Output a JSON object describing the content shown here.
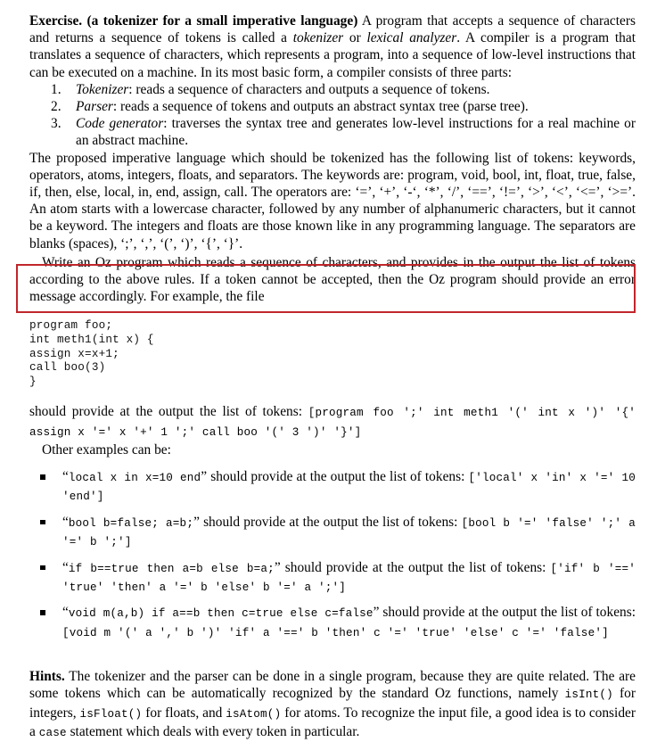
{
  "document": {
    "intro": {
      "heading": "Exercise.",
      "subheading": "(a tokenizer for a small imperative language)",
      "text_before_tokenizer": " A program that accepts a sequence of characters and returns a sequence of tokens is called a ",
      "em_tokenizer": "tokenizer",
      "text_or": " or ",
      "em_lexical": "lexical analyzer",
      "text_after": ". A compiler is a program that translates a sequence of characters, which represents a program, into a sequence of low-level instructions that can be executed on a machine. In its most basic form, a compiler consists of three parts:"
    },
    "parts": [
      {
        "num": "1.",
        "term": "Tokenizer",
        "desc": ": reads a sequence of characters and outputs a sequence of tokens."
      },
      {
        "num": "2.",
        "term": "Parser",
        "desc": ": reads a sequence of tokens and outputs an abstract syntax tree (parse tree)."
      },
      {
        "num": "3.",
        "term": "Code generator",
        "desc": ": traverses the syntax tree and generates low-level instructions for a real machine or an abstract machine."
      }
    ],
    "tokens_paragraph": {
      "line1": "The proposed imperative language which should be tokenized has the following list of tokens: keywords, operators, atoms, integers, floats, and separators. The keywords are: program, void, bool, int, float, true, false, if, then, else, local, in, end, assign, call. The operators are: ",
      "operators": "‘=’, ‘+’, ‘-‘, ‘*’, ‘/’, ‘==’, ‘!=’, ‘>’, ‘<’, ‘<=’, ‘>=’",
      "line2": ". An atom starts with a lowercase character, followed by any number of alphanumeric characters, but it cannot be a keyword. The integers and floats are those known like in any programming language. The separators are blanks (spaces), ",
      "separators": "‘;’, ‘,’, ‘(’, ‘)’, ‘{’, ‘}’",
      "line3": "."
    },
    "highlighted_task": "Write an Oz program which reads a sequence of characters, and provides in the output the list of tokens according to the above rules. If a token cannot be accepted, then the Oz program should provide an error message accordingly. For example, the file",
    "code_example": "program foo;\nint meth1(int x) {\nassign x=x+1;\ncall boo(3)\n}",
    "output_sentence": {
      "prose": "should provide at the output the list of tokens: ",
      "tokens": "[program foo ';' int meth1 '(' int x ')' '{' assign x '=' x '+' 1 ';' call boo '(' 3 ')' '}']"
    },
    "other_examples_label": "Other examples can be:",
    "examples": [
      {
        "quote_open": "“",
        "code": "local x in x=10 end",
        "quote_close": "”",
        "prose": " should provide at the output the list of tokens: ",
        "tokens": "['local' x 'in' x '=' 10 'end']"
      },
      {
        "quote_open": "“",
        "code": "bool b=false; a=b;",
        "quote_close": "”",
        "prose": " should provide at the output the list of tokens: ",
        "tokens": "[bool b '=' 'false' ';' a '=' b ';']"
      },
      {
        "quote_open": "“",
        "code": "if b==true then a=b else b=a;",
        "quote_close": "”",
        "prose": " should provide at the output the list of tokens: ",
        "tokens": "['if' b '==' 'true' 'then' a '=' b 'else' b '=' a ';']"
      },
      {
        "quote_open": "“",
        "code": "void m(a,b) if a==b then c=true else c=false",
        "quote_close": "”",
        "prose": " should provide at the output the list of tokens: ",
        "tokens": "[void m '(' a ',' b ')' 'if' a '==' b 'then' c '=' 'true' 'else' c '=' 'false']"
      }
    ],
    "hints": {
      "heading": "Hints.",
      "text1": " The tokenizer and the parser can be done in a single program, because they are quite related. The are some tokens which can be automatically recognized by the standard Oz functions, namely ",
      "fn_isint": "isInt()",
      "text2": " for integers, ",
      "fn_isfloat": "isFloat()",
      "text3": " for floats, and ",
      "fn_isatom": "isAtom()",
      "text4": " for atoms. To recognize the input file, a good idea is to consider a ",
      "kw_case": "case",
      "text5": " statement which deals with every token in particular."
    },
    "annotation": {
      "box_color": "#c0262b"
    }
  }
}
